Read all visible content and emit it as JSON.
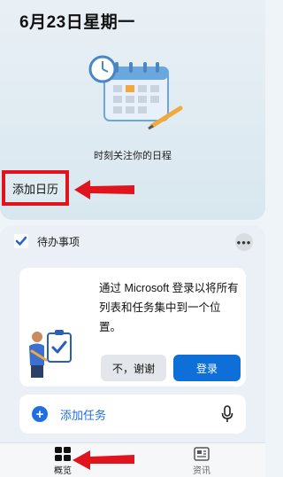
{
  "calendar": {
    "date_title": "6月23日星期一",
    "subtitle": "时刻关注你的日程",
    "add_calendar_label": "添加日历"
  },
  "todo": {
    "title": "待办事项",
    "more_label": "•••",
    "signin_message": "通过 Microsoft 登录以将所有列表和任务集中到一个位置。",
    "no_thanks_label": "不，谢谢",
    "login_label": "登录",
    "add_task_label": "添加任务"
  },
  "bottom_nav": {
    "tabs": [
      {
        "label": "概览",
        "icon": "grid-icon",
        "active": true
      },
      {
        "label": "资讯",
        "icon": "news-icon",
        "active": false
      }
    ]
  },
  "colors": {
    "accent": "#0f6fd9",
    "annotation_red": "#e0141c"
  }
}
